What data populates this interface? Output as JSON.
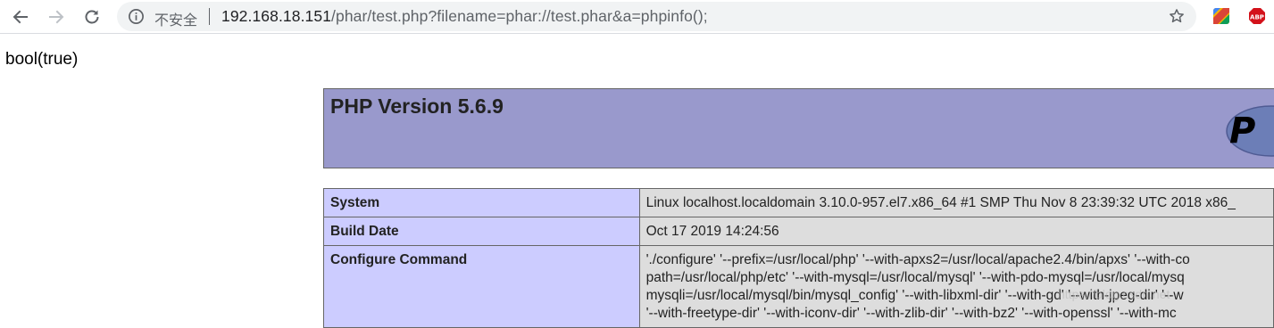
{
  "browser": {
    "security_label": "不安全",
    "url_host": "192.168.18.151",
    "url_path": "/phar/test.php?filename=phar://test.phar&a=phpinfo();",
    "icons": {
      "back": "back-arrow-icon",
      "forward": "forward-arrow-icon",
      "reload": "reload-icon",
      "info": "info-icon",
      "bookmark": "star-icon",
      "extension_1": "colorful-extension-icon",
      "extension_2": "adblock-plus-icon"
    },
    "adblock_label": "ABP"
  },
  "page": {
    "result_text": "bool(true)",
    "php_title": "PHP Version 5.6.9",
    "logo_text": "P",
    "rows": [
      {
        "label": "System",
        "value_lines": [
          "Linux localhost.localdomain 3.10.0-957.el7.x86_64 #1 SMP Thu Nov 8 23:39:32 UTC 2018 x86_"
        ]
      },
      {
        "label": "Build Date",
        "value_lines": [
          "Oct 17 2019 14:24:56"
        ]
      },
      {
        "label": "Configure Command",
        "value_lines": [
          "'./configure' '--prefix=/usr/local/php' '--with-apxs2=/usr/local/apache2.4/bin/apxs' '--with-co",
          "path=/usr/local/php/etc' '--with-mysql=/usr/local/mysql' '--with-pdo-mysql=/usr/local/mysq",
          "mysqli=/usr/local/mysql/bin/mysql_config' '--with-libxml-dir' '--with-gd' '--with-jpeg-dir' '--w",
          "'--with-freetype-dir' '--with-iconv-dir' '--with-zlib-dir' '--with-bz2' '--with-openssl' '--with-mc"
        ]
      }
    ]
  },
  "colors": {
    "header_bg": "#9999cc",
    "label_bg": "#ccccff",
    "value_bg": "#dddddd"
  }
}
